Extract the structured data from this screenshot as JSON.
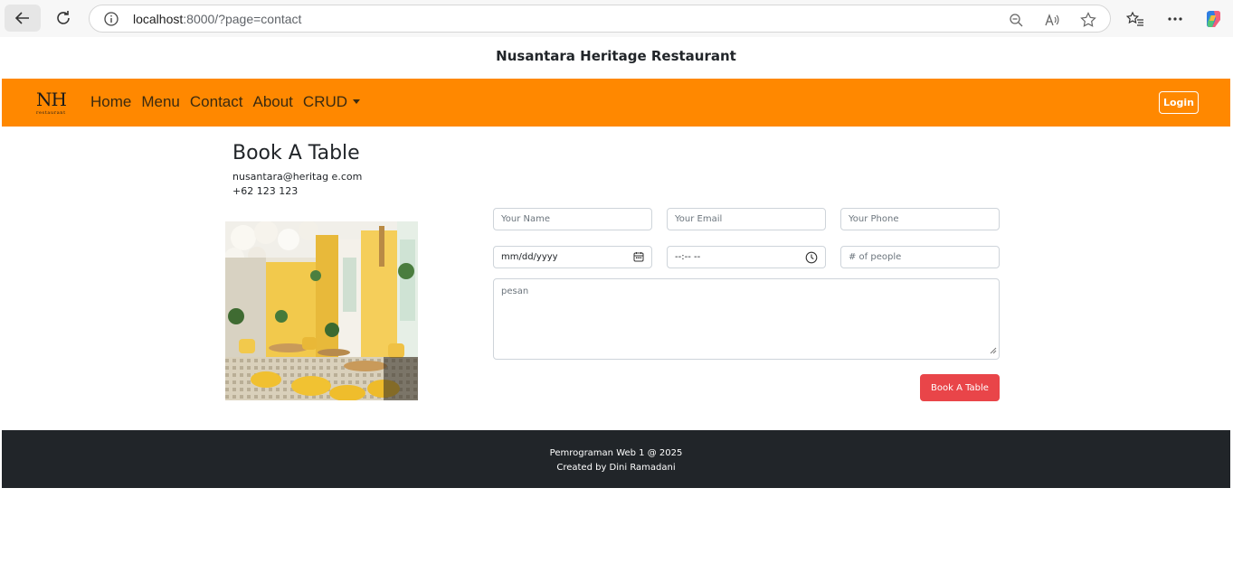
{
  "browser": {
    "url_host": "localhost",
    "url_rest": ":8000/?page=contact"
  },
  "site": {
    "title": "Nusantara Heritage Restaurant",
    "accent_color": "#ff8800"
  },
  "logo": {
    "text": "NH",
    "subtext": "restaurant"
  },
  "nav": {
    "items": [
      {
        "label": "Home"
      },
      {
        "label": "Menu"
      },
      {
        "label": "Contact"
      },
      {
        "label": "About"
      },
      {
        "label": "CRUD"
      }
    ],
    "login_label": "Login"
  },
  "booking": {
    "heading": "Book A Table",
    "email": "nusantara@heritag e.com",
    "phone": "+62 123 123",
    "fields": {
      "name_placeholder": "Your Name",
      "email_placeholder": "Your Email",
      "phone_placeholder": "Your Phone",
      "date_value": "mm/dd/yyyy",
      "time_value": "--:-- --",
      "people_placeholder": "# of people",
      "message_placeholder": "pesan"
    },
    "submit_label": "Book A Table",
    "submit_color": "#e94549"
  },
  "footer": {
    "line1": "Pemrograman Web 1 @ 2025",
    "line2": "Created by Dini Ramadani"
  }
}
